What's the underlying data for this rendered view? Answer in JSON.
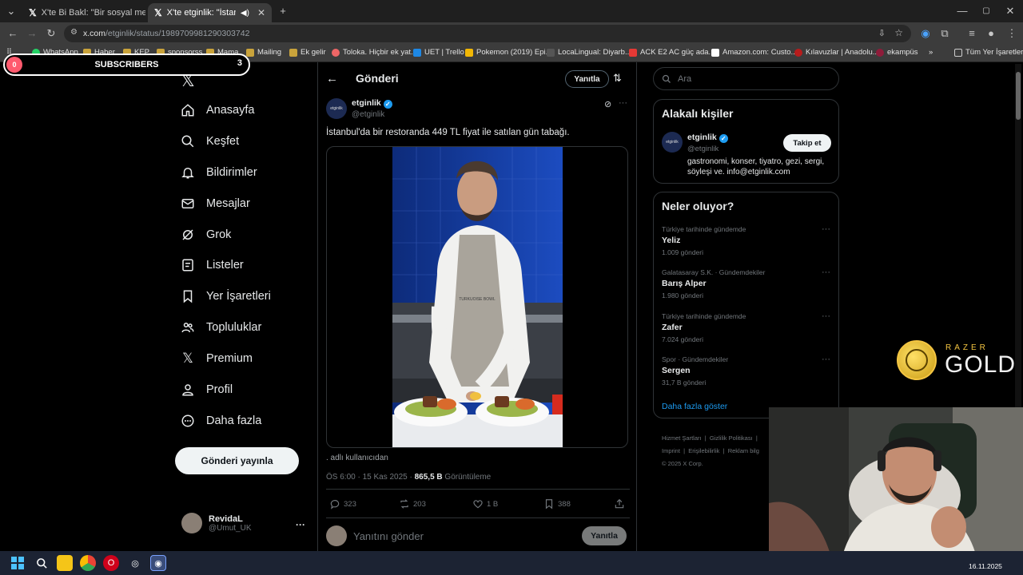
{
  "browser": {
    "tabs": [
      {
        "title": "X'te Bi Bakl: \"Bir sosyal medya b"
      },
      {
        "title": "X'te etginlik: \"İstanbul'da bi"
      }
    ],
    "new_tab": "+",
    "url_host": "x.com",
    "url_path": "/etginlik/status/1989709981290303742",
    "bookmarks": [
      "WhatsApp",
      "Haber",
      "KEP",
      "sponsorss",
      "Mama",
      "Mailing",
      "Ek gelir",
      "Toloka. Hiçbir ek yat...",
      "UET | Trello",
      "Pokemon (2019) Epi...",
      "LocaLingual: Diyarb...",
      "ACK E2 AC güç ada...",
      "Amazon.com: Custo...",
      "Kılavuzlar | Anadolu...",
      "ekampüs"
    ],
    "bookmarks_more": "»",
    "bookmarks_all": "Tüm Yer İşaretleri"
  },
  "overlay": {
    "subscribers_label": "SUBSCRIBERS",
    "subscribers_left": "0",
    "subscribers_count": "3",
    "razer_brand": "RAZER",
    "razer_gold": "GOLD"
  },
  "nav": {
    "logo": "𝕏",
    "items": [
      {
        "label": "Anasayfa",
        "icon": "home-icon"
      },
      {
        "label": "Keşfet",
        "icon": "search-icon"
      },
      {
        "label": "Bildirimler",
        "icon": "bell-icon"
      },
      {
        "label": "Mesajlar",
        "icon": "mail-icon"
      },
      {
        "label": "Grok",
        "icon": "grok-icon"
      },
      {
        "label": "Listeler",
        "icon": "list-icon"
      },
      {
        "label": "Yer İşaretleri",
        "icon": "bookmark-icon"
      },
      {
        "label": "Topluluklar",
        "icon": "communities-icon"
      },
      {
        "label": "Premium",
        "icon": "x-premium-icon"
      },
      {
        "label": "Profil",
        "icon": "profile-icon"
      },
      {
        "label": "Daha fazla",
        "icon": "more-circle-icon"
      }
    ],
    "post_button": "Gönderi yayınla",
    "user_name": "RevidaL",
    "user_handle": "@Umut_UK",
    "user_more": "···"
  },
  "post": {
    "header_title": "Gönderi",
    "reply_pill": "Yanıtla",
    "author_name": "etginlik",
    "author_handle": "@etginlik",
    "avatar_text": "etginlik",
    "text": "İstanbul'da bir restoranda 449 TL fiyat ile satılan gün tabağı.",
    "video_apron_text": "TURKUOISE BOWL",
    "attribution": ". adlı kullanıcıdan",
    "time": "ÖS 6:00 · 15 Kas 2025 · ",
    "views": "865,5 B",
    "views_label": " Görüntüleme",
    "replies": "323",
    "reposts": "203",
    "likes": "1 B",
    "bookmarks": "388",
    "reply_placeholder": "Yanıtını gönder",
    "reply_button": "Yanıtla"
  },
  "sidebar": {
    "search_placeholder": "Ara",
    "related_title": "Alakalı kişiler",
    "related_name": "etginlik",
    "related_handle": "@etginlik",
    "related_bio": "gastronomi, konser, tiyatro, gezi, sergi, söyleşi ve. info@etginlik.com",
    "follow_button": "Takip et",
    "trends_title": "Neler oluyor?",
    "trends": [
      {
        "category": "Türkiye tarihinde gündemde",
        "name": "Yeliz",
        "count": "1.009 gönderi"
      },
      {
        "category": "Galatasaray S.K. · Gündemdekiler",
        "name": "Barış Alper",
        "count": "1.980 gönderi"
      },
      {
        "category": "Türkiye tarihinde gündemde",
        "name": "Zafer",
        "count": "7.024 gönderi"
      },
      {
        "category": "Spor · Gündemdekiler",
        "name": "Sergen",
        "count": "31,7 B gönderi"
      }
    ],
    "show_more": "Daha fazla göster",
    "footer": [
      "Hizmet Şartları",
      "Gizlilik Politikası",
      "|",
      "Imprint",
      "Erişilebilirlik",
      "Reklam bilg"
    ],
    "copyright": "© 2025 X Corp."
  },
  "taskbar": {
    "date": "16.11.2025"
  },
  "colors": {
    "accent": "#1d9bf0",
    "background": "#000000",
    "border": "#2f3336",
    "muted": "#71767b"
  }
}
